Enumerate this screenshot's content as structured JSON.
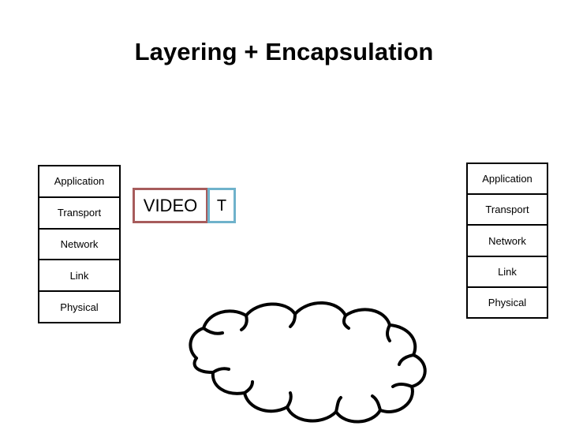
{
  "slide": {
    "title": "Layering + Encapsulation"
  },
  "left_stack": {
    "name": "sender-protocol-stack",
    "layers": [
      {
        "label": "Application"
      },
      {
        "label": "Transport"
      },
      {
        "label": "Network"
      },
      {
        "label": "Link"
      },
      {
        "label": "Physical"
      }
    ]
  },
  "right_stack": {
    "name": "receiver-protocol-stack",
    "layers": [
      {
        "label": "Application"
      },
      {
        "label": "Transport"
      },
      {
        "label": "Network"
      },
      {
        "label": "Link"
      },
      {
        "label": "Physical"
      }
    ]
  },
  "packet": {
    "payload_label": "VIDEO",
    "header_label": "T",
    "payload_border_color": "#a75c5c",
    "header_border_color": "#6fb2cb"
  },
  "cloud": {
    "label": "network-cloud",
    "stroke_color": "#000000"
  }
}
